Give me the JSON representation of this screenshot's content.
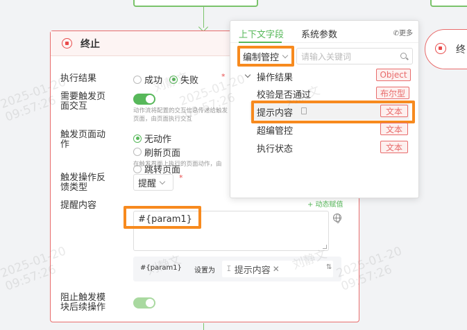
{
  "canvas": {
    "right_node_label": "终"
  },
  "panel": {
    "title": "终止",
    "exec_result": {
      "label": "执行结果",
      "options": [
        "成功",
        "失败"
      ],
      "selected": "失败",
      "required_mark": "*"
    },
    "need_interaction": {
      "label": "需要触发页面交互",
      "hint": "动作流将配置的交互信息传递给触发页面，由页面执行交互"
    },
    "page_action": {
      "label": "触发页面动作",
      "options": [
        "无动作",
        "刷新页面",
        "跳转页面"
      ],
      "selected": "无动作",
      "hint": "在触发界面上执行的页面动作，由"
    },
    "feedback_type": {
      "label": "触发操作反馈类型",
      "value": "提醒",
      "required_mark": "*"
    },
    "message": {
      "label": "提醒内容",
      "dynamic_link": "+ 动态赋值",
      "value": "#{param1}",
      "assign": {
        "param": "#{param1}",
        "set_as": "设置为",
        "tag": "提示内容"
      }
    },
    "block_follow": {
      "label": "阻止触发模块后续操作"
    }
  },
  "popup": {
    "tabs": [
      "上下文字段",
      "系统参数"
    ],
    "active_tab": "上下文字段",
    "more": "更多",
    "category": "编制管控",
    "search_placeholder": "请输入关键词",
    "parent": {
      "name": "操作结果",
      "type": "Object"
    },
    "fields": [
      {
        "name": "校验是否通过",
        "type": "布尔型"
      },
      {
        "name": "提示内容",
        "type": "文本"
      },
      {
        "name": "超编管控",
        "type": "文本"
      },
      {
        "name": "执行状态",
        "type": "文本"
      }
    ]
  },
  "watermark": {
    "name": "刘静文",
    "date": "2025-01-20",
    "time": "09:57:26"
  },
  "colors": {
    "accent_green": "#57b85a",
    "stop_red": "#e84b4b",
    "highlight_orange": "#f78a1e"
  }
}
